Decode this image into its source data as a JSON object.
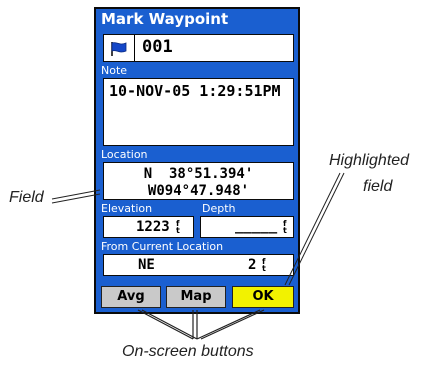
{
  "window": {
    "title": "Mark Waypoint"
  },
  "waypoint": {
    "name": "001",
    "icon": "flag-icon"
  },
  "note": {
    "label": "Note",
    "value": "10-NOV-05 1:29:51PM"
  },
  "location": {
    "label": "Location",
    "lat": "N  38°51.394'",
    "lon": "W094°47.948'"
  },
  "elevation": {
    "label": "Elevation",
    "value": "1223",
    "unit_top": "f",
    "unit_bottom": "t"
  },
  "depth": {
    "label": "Depth",
    "value": "_____",
    "unit_top": "f",
    "unit_bottom": "t"
  },
  "from_current": {
    "label": "From Current Location",
    "bearing": "NE",
    "distance": "2",
    "unit_top": "f",
    "unit_bottom": "t"
  },
  "buttons": {
    "avg": "Avg",
    "map": "Map",
    "ok": "OK"
  },
  "callouts": {
    "field": "Field",
    "highlighted_line1": "Highlighted",
    "highlighted_line2": "field",
    "onscreen": "On-screen buttons"
  },
  "colors": {
    "screen_bg": "#1a5fd0",
    "highlight": "#f2f200",
    "button": "#c9c9c9"
  }
}
